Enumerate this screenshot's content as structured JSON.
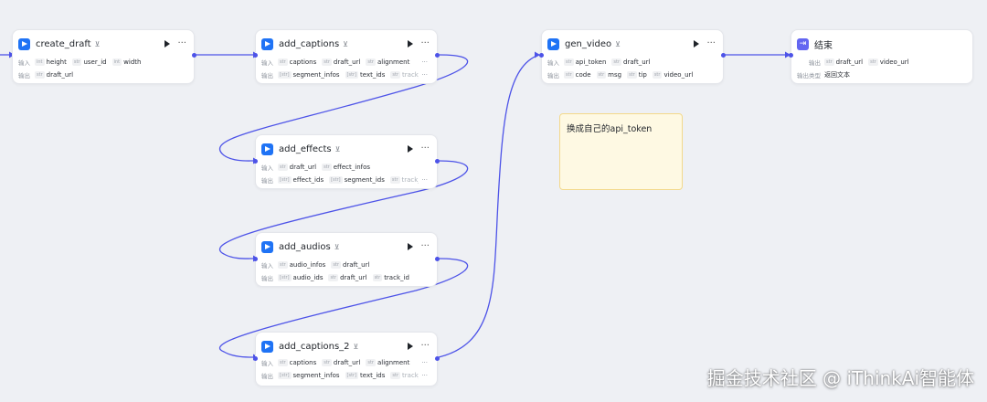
{
  "labels": {
    "input": "输入",
    "output": "输出",
    "output_type": "输出类型",
    "more": "···",
    "run_icon": "play-icon",
    "version_icon": "⊻"
  },
  "nodes": {
    "create_draft": {
      "title": "create_draft",
      "inputs": [
        {
          "type": "int",
          "name": "height"
        },
        {
          "type": "str",
          "name": "user_id"
        },
        {
          "type": "int",
          "name": "width"
        }
      ],
      "outputs": [
        {
          "type": "str",
          "name": "draft_url"
        }
      ]
    },
    "add_captions": {
      "title": "add_captions",
      "inputs": [
        {
          "type": "str",
          "name": "captions"
        },
        {
          "type": "str",
          "name": "draft_url"
        },
        {
          "type": "str",
          "name": "alignment"
        }
      ],
      "outputs": [
        {
          "type": "[str]",
          "name": "segment_infos"
        },
        {
          "type": "[str]",
          "name": "text_ids"
        },
        {
          "type": "str",
          "name": "track_"
        }
      ]
    },
    "add_effects": {
      "title": "add_effects",
      "inputs": [
        {
          "type": "str",
          "name": "draft_url"
        },
        {
          "type": "str",
          "name": "effect_infos"
        }
      ],
      "outputs": [
        {
          "type": "[str]",
          "name": "effect_ids"
        },
        {
          "type": "[str]",
          "name": "segment_ids"
        },
        {
          "type": "str",
          "name": "track_"
        }
      ]
    },
    "add_audios": {
      "title": "add_audios",
      "inputs": [
        {
          "type": "str",
          "name": "audio_infos"
        },
        {
          "type": "str",
          "name": "draft_url"
        }
      ],
      "outputs": [
        {
          "type": "[str]",
          "name": "audio_ids"
        },
        {
          "type": "str",
          "name": "draft_url"
        },
        {
          "type": "str",
          "name": "track_id"
        }
      ]
    },
    "add_captions_2": {
      "title": "add_captions_2",
      "inputs": [
        {
          "type": "str",
          "name": "captions"
        },
        {
          "type": "str",
          "name": "draft_url"
        },
        {
          "type": "str",
          "name": "alignment"
        }
      ],
      "outputs": [
        {
          "type": "[str]",
          "name": "segment_infos"
        },
        {
          "type": "[str]",
          "name": "text_ids"
        },
        {
          "type": "str",
          "name": "track_"
        }
      ]
    },
    "gen_video": {
      "title": "gen_video",
      "inputs": [
        {
          "type": "str",
          "name": "api_token"
        },
        {
          "type": "str",
          "name": "draft_url"
        }
      ],
      "outputs": [
        {
          "type": "str",
          "name": "code"
        },
        {
          "type": "str",
          "name": "msg"
        },
        {
          "type": "str",
          "name": "tip"
        },
        {
          "type": "str",
          "name": "video_url"
        }
      ]
    },
    "end": {
      "title": "结束",
      "inputs": [
        {
          "type": "str",
          "name": "draft_url"
        },
        {
          "type": "str",
          "name": "video_url"
        }
      ],
      "output_text": "返回文本"
    }
  },
  "note": {
    "text": "换成自己的api_token"
  },
  "watermark": "掘金技术社区 @ iThinkAi智能体",
  "colors": {
    "edge": "#4d53e8",
    "plugin_icon": "#1f73f5",
    "end_icon": "#6366f1",
    "note_bg": "#fef9e3"
  }
}
